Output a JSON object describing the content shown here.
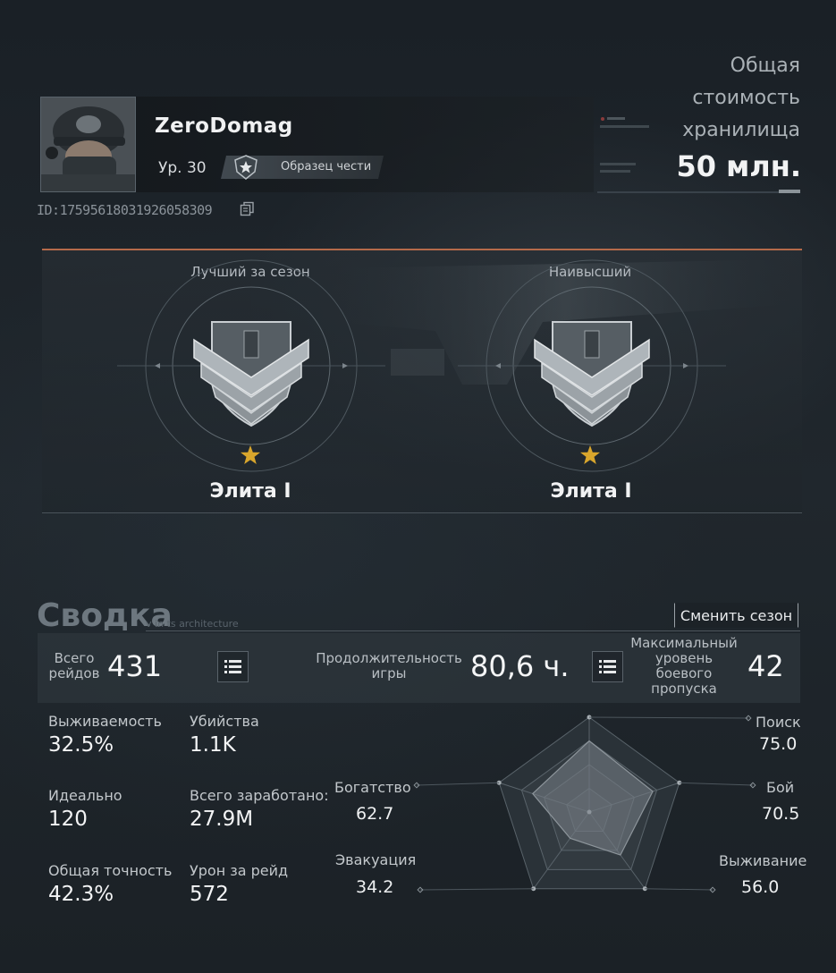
{
  "profile": {
    "username": "ZeroDomag",
    "level": "Ур. 30",
    "honor_title": "Образец чести",
    "player_id": "ID:17595618031926058309"
  },
  "storage": {
    "label_line1": "Общая",
    "label_line2": "стоимость",
    "label_line3": "хранилища",
    "value": "50 млн."
  },
  "ranks": {
    "season_best": {
      "title": "Лучший за сезон",
      "name": "Элита I"
    },
    "highest": {
      "title": "Наивысший",
      "name": "Элита I"
    }
  },
  "summary": {
    "title": "Сводка",
    "subtitle": "v in ts architecture",
    "change_season_label": "Сменить сезон",
    "total_raids": {
      "label_line1": "Всего",
      "label_line2": "рейдов",
      "value": "431"
    },
    "playtime": {
      "label_line1": "Продолжительность",
      "label_line2": "игры",
      "value": "80,6 ч."
    },
    "battle_pass": {
      "label_line1": "Максимальный",
      "label_line2": "уровень",
      "label_line3": "боевого",
      "label_line4": "пропуска",
      "value": "42"
    },
    "stats": [
      {
        "label": "Выживаемость",
        "value": "32.5%"
      },
      {
        "label": "Убийства",
        "value": "1.1K"
      },
      {
        "label": "Идеально",
        "value": "120"
      },
      {
        "label": "Всего заработано:",
        "value": "27.9M"
      },
      {
        "label": "Общая точность",
        "value": "42.3%"
      },
      {
        "label": "Урон за рейд",
        "value": "572"
      }
    ]
  },
  "radar": {
    "axes": [
      {
        "label": "Поиск",
        "value": "75.0",
        "score": 75.0
      },
      {
        "label": "Бой",
        "value": "70.5",
        "score": 70.5
      },
      {
        "label": "Выживание",
        "value": "56.0",
        "score": 56.0
      },
      {
        "label": "Эвакуация",
        "value": "34.2",
        "score": 34.2
      },
      {
        "label": "Богатство",
        "value": "62.7",
        "score": 62.7
      }
    ]
  },
  "colors": {
    "accent_line": "#b56a4a",
    "star": "#d9a62c",
    "background": "#1c2227"
  }
}
